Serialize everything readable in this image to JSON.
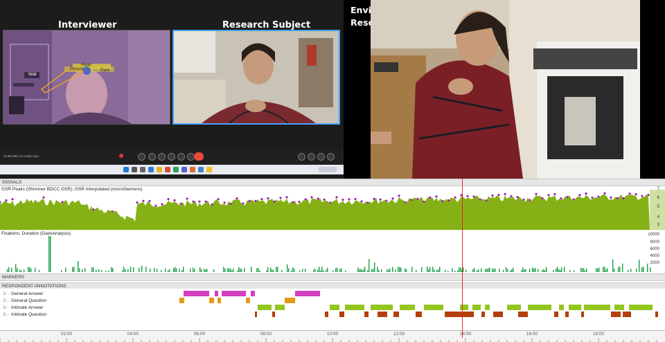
{
  "video": {
    "interviewer_label": "Interviewer",
    "subject_label": "Research Subject",
    "env_camera_label_1": "Environment Camera",
    "env_camera_label_2": "Research Subject set up",
    "clock": "11:00 AM",
    "meeting_info": "  |  mtv-sadip-rapn",
    "overlay_tags": [
      "Wall",
      "Person",
      "Head",
      "Eyes"
    ]
  },
  "panel": {
    "signals_header": "SIGNALS",
    "gsr_title": "GSR Peaks (Shimmer BDCC GSR); GSR Interpolated (microSiemens)",
    "gsr_ticks": [
      "7",
      "6",
      "5",
      "4",
      "3"
    ],
    "fix_title": "Fixations: Duration (GazeAnalysis)",
    "fix_ticks": [
      "10000",
      "8000",
      "6000",
      "4000",
      "2000"
    ],
    "markers_header": "MARKERS",
    "annotations_header": "RESPONDENT ANNOTATIONS",
    "annotation_rows": [
      {
        "label": "General Answer",
        "color": "#d43fbf"
      },
      {
        "label": "General Question",
        "color": "#e39a1b"
      },
      {
        "label": "Intimate Answer",
        "color": "#93c61f"
      },
      {
        "label": "Intimate Question",
        "color": "#b3400c"
      }
    ],
    "timeline_labels": [
      "02:00",
      "04:00",
      "06:00",
      "08:00",
      "10:00",
      "12:00",
      "14:00",
      "16:00",
      "18:00"
    ]
  },
  "colors": {
    "gsr_fill": "#86b116",
    "gsr_peak": "#9b1fb6",
    "fixation_bar": "#17a046",
    "playhead": "#e4222a"
  }
}
